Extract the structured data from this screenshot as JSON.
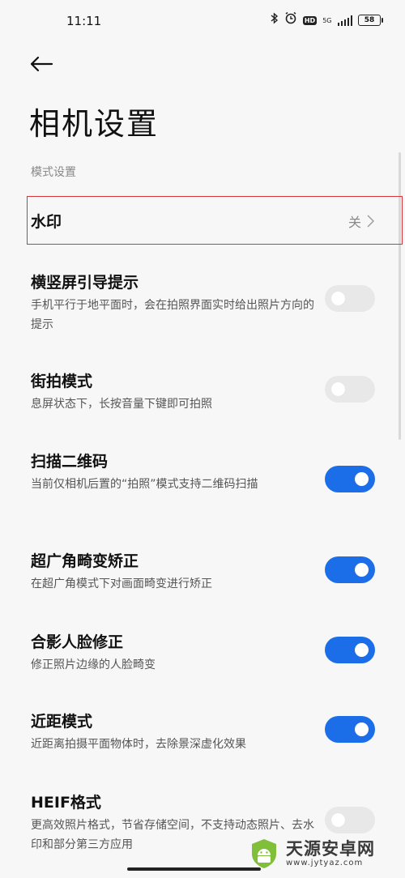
{
  "status_bar": {
    "time": "11:11",
    "network": "5G",
    "hd": "HD",
    "battery": "58"
  },
  "header": {
    "title": "相机设置"
  },
  "section": {
    "label": "模式设置"
  },
  "watermark": {
    "title": "水印",
    "value": "关"
  },
  "settings": [
    {
      "title": "横竖屏引导提示",
      "desc": "手机平行于地平面时，会在拍照界面实时给出照片方向的提示",
      "enabled": false
    },
    {
      "title": "街拍模式",
      "desc": "息屏状态下，长按音量下键即可拍照",
      "enabled": false
    },
    {
      "title": "扫描二维码",
      "desc": "当前仅相机后置的“拍照”模式支持二维码扫描",
      "enabled": true
    },
    {
      "title": "超广角畸变矫正",
      "desc": "在超广角模式下对画面畸变进行矫正",
      "enabled": true
    },
    {
      "title": "合影人脸修正",
      "desc": "修正照片边缘的人脸畸变",
      "enabled": true
    },
    {
      "title": "近距模式",
      "desc": "近距离拍摄平面物体时，去除景深虚化效果",
      "enabled": true
    },
    {
      "title": "HEIF格式",
      "desc": "更高效照片格式，节省存储空间，不支持动态照片、去水印和部分第三方应用",
      "enabled": false
    }
  ],
  "watermark_logo": {
    "name": "天源安卓网",
    "url": "www.jytyaz.com"
  },
  "colors": {
    "accent": "#1b6ee8",
    "highlight_border": "#d9343a",
    "toggle_off": "#e8e8e8"
  }
}
